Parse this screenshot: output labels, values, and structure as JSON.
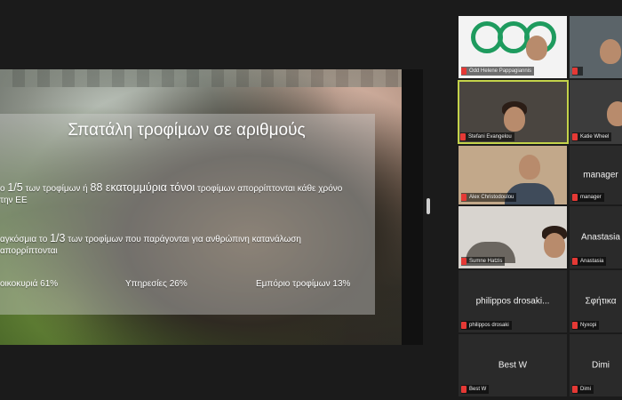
{
  "slide": {
    "title": "Σπατάλη τροφίμων σε αριθμούς",
    "line1_pre": "ο ",
    "line1_frac": "1/5",
    "line1_mid": " των τροφίμων ή ",
    "line1_big": "88 εκατομμύρια τόνοι",
    "line1_post": " τροφίμων απορρίπτονται κάθε χρόνο",
    "line1b": "την ΕΕ",
    "line2_pre": "αγκόσμια το ",
    "line2_frac": "1/3",
    "line2_post": " των τροφίμων που παράγονται για ανθρώπινη κατανάλωση",
    "line2b": "απορρίπτονται",
    "stat_households": "οικοκυριά  61%",
    "stat_services": "Υπηρεσίες 26%",
    "stat_retail": "Εμπόριο τροφίμων 13%"
  },
  "participants": [
    {
      "name": "Odd Helene Pappagiannis"
    },
    {
      "name": ""
    },
    {
      "name": "Stefani Evangelou"
    },
    {
      "name": "Katie Wheel"
    },
    {
      "name": "Alex Christodoulou"
    },
    {
      "name": "manager"
    },
    {
      "name": "Sumne Hatzis"
    },
    {
      "name": "Anastasia"
    },
    {
      "name": "philippos drosaki"
    },
    {
      "name": "Nyxopi"
    },
    {
      "name": "Best W"
    },
    {
      "name": "Dimi"
    }
  ],
  "center_names": {
    "tile8": "philippos drosaki...",
    "tile9": "Σφήτικα",
    "tile10": "Best W",
    "tile11": "Dimi",
    "tile5": "manager",
    "tile7": "Anastasia"
  }
}
